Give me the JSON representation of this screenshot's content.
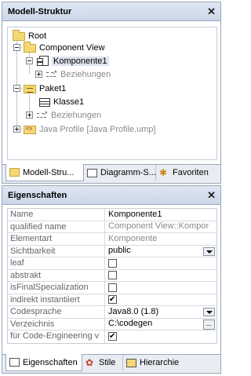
{
  "model_panel": {
    "title": "Modell-Struktur",
    "close_glyph": "✕",
    "tree": [
      {
        "label": "Root",
        "icon": "folder-icon",
        "style": "normal"
      },
      {
        "label": "Component View",
        "icon": "folder-icon",
        "style": "normal"
      },
      {
        "label": "Komponente1",
        "icon": "component-icon",
        "style": "selected"
      },
      {
        "label": "Beziehungen",
        "icon": "relations-icon",
        "style": "grey"
      },
      {
        "label": "Paket1",
        "icon": "package-icon",
        "style": "normal"
      },
      {
        "label": "Klasse1",
        "icon": "class-icon",
        "style": "normal"
      },
      {
        "label": "Beziehungen",
        "icon": "relations-icon",
        "style": "grey"
      },
      {
        "label": "Java Profile [Java Profile.ump]",
        "icon": "java-profile-icon",
        "style": "grey"
      }
    ],
    "tabs": [
      {
        "label": "Modell-Stru...",
        "icon": "folder-icon",
        "active": true
      },
      {
        "label": "Diagramm-S...",
        "icon": "diagram-icon",
        "active": false
      },
      {
        "label": "Favoriten",
        "icon": "favorites-icon",
        "active": false
      }
    ]
  },
  "props_panel": {
    "title": "Eigenschaften",
    "close_glyph": "✕",
    "rows": [
      {
        "name": "Name",
        "value": "Komponente1",
        "kind": "text"
      },
      {
        "name": "qualified name",
        "value": "Component View::Kompor",
        "kind": "grey"
      },
      {
        "name": "Elementart",
        "value": "Komponente",
        "kind": "grey"
      },
      {
        "name": "Sichtbarkeit",
        "value": "public",
        "kind": "dropdown"
      },
      {
        "name": "leaf",
        "value": "",
        "kind": "checkbox",
        "checked": false
      },
      {
        "name": "abstrakt",
        "value": "",
        "kind": "checkbox",
        "checked": false
      },
      {
        "name": "isFinalSpecialization",
        "value": "",
        "kind": "checkbox",
        "checked": false
      },
      {
        "name": "indirekt instantiiert",
        "value": "",
        "kind": "checkbox",
        "checked": true
      },
      {
        "name": "Codesprache",
        "value": "Java8.0 (1.8)",
        "kind": "dropdown"
      },
      {
        "name": "Verzeichnis",
        "value": "C:\\codegen",
        "kind": "browse"
      },
      {
        "name": "für Code-Engineering v",
        "value": "",
        "kind": "checkbox",
        "checked": true
      }
    ],
    "browse_label": "...",
    "tabs": [
      {
        "label": "Eigenschaften",
        "icon": "properties-icon",
        "active": true
      },
      {
        "label": "Stile",
        "icon": "styles-icon",
        "active": false
      },
      {
        "label": "Hierarchie",
        "icon": "hierarchy-icon",
        "active": false
      }
    ]
  }
}
